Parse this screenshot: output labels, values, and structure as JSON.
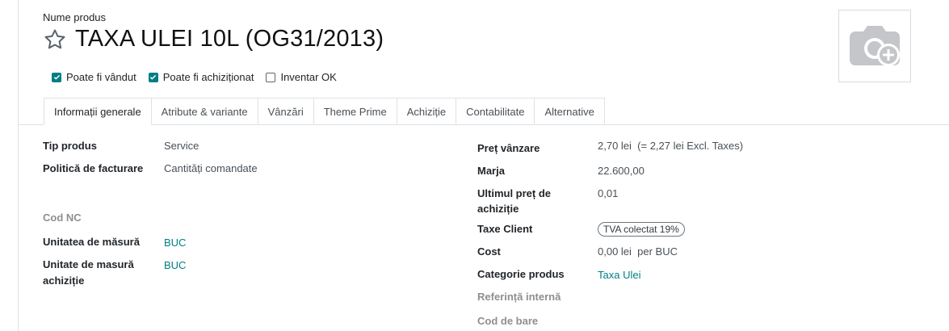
{
  "header": {
    "field_label": "Nume produs",
    "title": "TAXA ULEI 10L (OG31/2013)"
  },
  "checkboxes": [
    {
      "label": "Poate fi vândut",
      "checked": true
    },
    {
      "label": "Poate fi achiziționat",
      "checked": true
    },
    {
      "label": "Inventar OK",
      "checked": false
    }
  ],
  "tabs": [
    {
      "label": "Informații generale",
      "active": true
    },
    {
      "label": "Atribute & variante",
      "active": false
    },
    {
      "label": "Vânzări",
      "active": false
    },
    {
      "label": "Theme Prime",
      "active": false
    },
    {
      "label": "Achiziție",
      "active": false
    },
    {
      "label": "Contabilitate",
      "active": false
    },
    {
      "label": "Alternative",
      "active": false
    }
  ],
  "left": {
    "tip_produs": {
      "label": "Tip produs",
      "value": "Service"
    },
    "politica": {
      "label": "Politică de facturare",
      "value": "Cantități comandate"
    },
    "cod_nc": {
      "label": "Cod NC"
    },
    "um": {
      "label": "Unitatea de măsură",
      "value": "BUC"
    },
    "um_achizitie": {
      "label_line1": "Unitate de masură",
      "label_line2": "achiziție",
      "value": "BUC"
    }
  },
  "right": {
    "pret_vanzare": {
      "label": "Preț vânzare",
      "value": "2,70 lei",
      "note": "(= 2,27 lei Excl. Taxes)"
    },
    "marja": {
      "label": "Marja",
      "value": "22.600,00"
    },
    "ultimul_pret": {
      "label_line1": "Ultimul preț de",
      "label_line2": "achiziție",
      "value": "0,01"
    },
    "taxe_client": {
      "label": "Taxe Client",
      "badge": "TVA colectat 19%"
    },
    "cost": {
      "label": "Cost",
      "value": "0,00 lei",
      "unit": "per BUC"
    },
    "categorie": {
      "label": "Categorie produs",
      "value": "Taxa Ulei"
    },
    "referinta": {
      "label": "Referință internă"
    },
    "cod_bare": {
      "label": "Cod de bare"
    }
  },
  "colors": {
    "accent": "#017e84",
    "border": "#dee2e6"
  },
  "icons": {
    "favorite": "star-outline-icon",
    "image": "camera-add-icon"
  }
}
